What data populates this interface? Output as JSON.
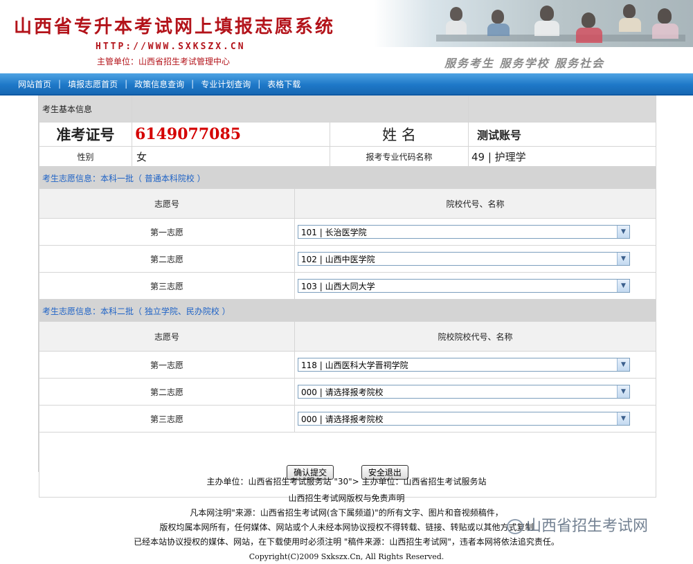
{
  "header": {
    "title": "山西省专升本考试网上填报志愿系统",
    "url": "HTTP://WWW.SXKSZX.CN",
    "sponsor": "主管单位：山西省招生考试管理中心",
    "slogan": "服务考生  服务学校  服务社会"
  },
  "nav": {
    "items": [
      "网站首页",
      "填报志愿首页",
      "政策信息查询",
      "专业计划查询",
      "表格下载"
    ],
    "separator": "|"
  },
  "student": {
    "section_title": "考生基本信息",
    "id_label": "准考证号",
    "id_value": "6149077085",
    "name_label": "姓 名",
    "name_value": "测试账号",
    "gender_label": "性别",
    "gender_value": "女",
    "major_label": "报考专业代码名称",
    "major_value": "49 | 护理学"
  },
  "batch1": {
    "title": "考生志愿信息：本科一批（ 普通本科院校 ）",
    "col_no": "志愿号",
    "col_school": "院校代号、名称",
    "choices": [
      {
        "label": "第一志愿",
        "value": "101 | 长治医学院"
      },
      {
        "label": "第二志愿",
        "value": "102 | 山西中医学院"
      },
      {
        "label": "第三志愿",
        "value": "103 | 山西大同大学"
      }
    ]
  },
  "batch2": {
    "title": "考生志愿信息：本科二批（ 独立学院、民办院校 ）",
    "col_no": "志愿号",
    "col_school": "院校院校代号、名称",
    "choices": [
      {
        "label": "第一志愿",
        "value": "118 | 山西医科大学晋祠学院"
      },
      {
        "label": "第二志愿",
        "value": "000 | 请选择报考院校"
      },
      {
        "label": "第三志愿",
        "value": "000 | 请选择报考院校"
      }
    ]
  },
  "buttons": {
    "submit": "确认提交",
    "logout": "安全退出"
  },
  "footer": {
    "line1": "主办单位：山西省招生考试服务站 \"30\"> 主办单位：山西省招生考试服务站",
    "line2": "山西招生考试网版权与免责声明",
    "line3": "凡本网注明\"来源：山西省招生考试网(含下属频道)\"的所有文字、图片和音视频稿件，",
    "line4": "版权均属本网所有，任何媒体、网站或个人未经本网协议授权不得转载、链接、转贴或以其他方式复制",
    "line5": "已经本站协议授权的媒体、网站，在下载使用时必须注明 \"稿件来源：山西招生考试网\"，违者本网将依法追究责任。",
    "copyright": "Copyright(C)2009 Sxkszx.Cn, All Rights Reserved."
  },
  "watermark": "山西省招生考试网",
  "colors": {
    "brand_red": "#b3131a",
    "nav_blue": "#1e78c8",
    "section_blue": "#1f63c6",
    "id_red": "#d40000"
  }
}
